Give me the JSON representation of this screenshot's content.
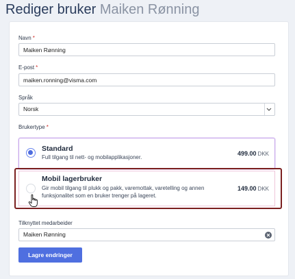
{
  "page": {
    "title_action": "Rediger bruker",
    "title_name": "Maiken Rønning"
  },
  "form": {
    "name": {
      "label": "Navn",
      "required": "*",
      "value": "Maiken Rønning"
    },
    "email": {
      "label": "E-post",
      "required": "*",
      "value": "maiken.ronning@visma.com"
    },
    "language": {
      "label": "Språk",
      "value": "Norsk"
    },
    "user_type": {
      "label": "Brukertype",
      "required": "*",
      "options": [
        {
          "title": "Standard",
          "description": "Full tilgang til nett- og mobilapplikasjoner.",
          "price": "499.00",
          "currency": "DKK",
          "selected": true
        },
        {
          "title": "Mobil lagerbruker",
          "description_line1": "Gir mobil tilgang til plukk og pakk, varemottak, varetelling og annen",
          "description_line2": "funksjonalitet som en bruker trenger på lageret.",
          "price": "149.00",
          "currency": "DKK",
          "selected": false
        }
      ]
    },
    "linked_employee": {
      "label": "Tilknyttet medarbeider",
      "value": "Maiken Rønning"
    },
    "save_label": "Lagre endringer"
  },
  "colors": {
    "primary": "#4f6fe0",
    "highlight_border": "#7a1f1f",
    "required": "#d0312d"
  },
  "icons": [
    "chevron-down-icon",
    "clear-icon",
    "hand-cursor-icon"
  ]
}
